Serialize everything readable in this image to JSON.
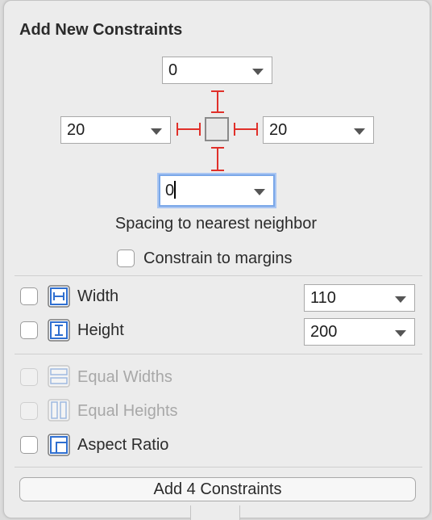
{
  "popover": {
    "title": "Add New Constraints",
    "spacing": {
      "top": "0",
      "leading": "20",
      "trailing": "20",
      "bottom": "0"
    },
    "spacing_caption": "Spacing to nearest neighbor",
    "constrain_to_margins_label": "Constrain to margins",
    "width_label": "Width",
    "width_value": "110",
    "height_label": "Height",
    "height_value": "200",
    "equal_widths_label": "Equal Widths",
    "equal_heights_label": "Equal Heights",
    "aspect_ratio_label": "Aspect Ratio",
    "add_button_label": "Add 4 Constraints",
    "strut_color": "#e0302a",
    "icon_color": "#2f6fd0"
  }
}
